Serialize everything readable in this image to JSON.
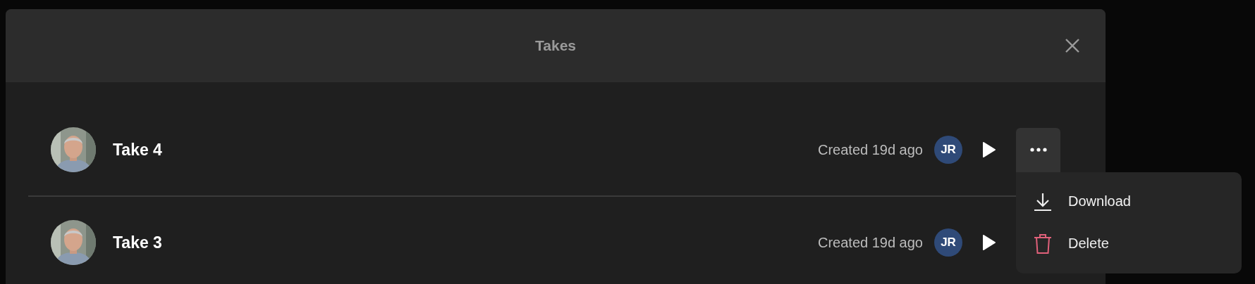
{
  "dialog": {
    "title": "Takes"
  },
  "takes": [
    {
      "name": "Take 4",
      "created": "Created 19d ago",
      "author_initials": "JR",
      "menu": {
        "open": true,
        "items": [
          {
            "kind": "download",
            "label": "Download",
            "destructive": false
          },
          {
            "kind": "delete",
            "label": "Delete",
            "destructive": true
          }
        ]
      }
    },
    {
      "name": "Take 3",
      "created": "Created 19d ago",
      "author_initials": "JR"
    }
  ]
}
